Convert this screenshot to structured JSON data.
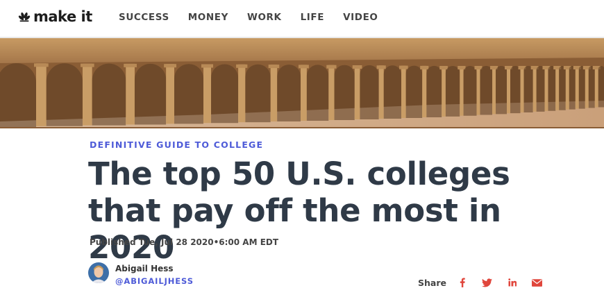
{
  "brand": {
    "logo_text": "make it"
  },
  "nav": {
    "items": [
      "SUCCESS",
      "MONEY",
      "WORK",
      "LIFE",
      "VIDEO"
    ]
  },
  "article": {
    "kicker": "DEFINITIVE GUIDE TO COLLEGE",
    "title": "The top 50 U.S. colleges that pay off the most in 2020",
    "published": "Published Tue, Jul 28 2020•6:00 AM EDT"
  },
  "author": {
    "name": "Abigail Hess",
    "handle": "@ABIGAILJHESS"
  },
  "share": {
    "label": "Share",
    "icons": [
      "facebook-icon",
      "twitter-icon",
      "linkedin-icon",
      "email-icon"
    ]
  },
  "colors": {
    "accent": "#4e5bd8",
    "share_icon": "#e0463c",
    "headline": "#2f3a47"
  }
}
